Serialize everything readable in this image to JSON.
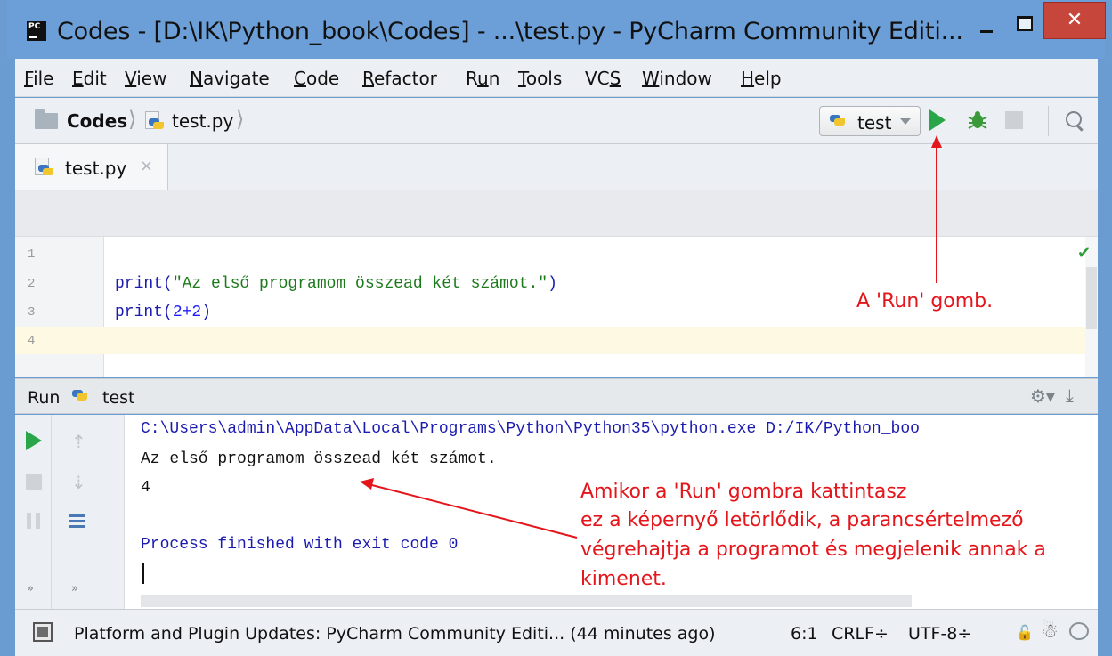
{
  "window": {
    "title": "Codes - [D:\\IK\\Python_book\\Codes] - ...\\test.py - PyCharm Community Editi...",
    "close_glyph": "✕"
  },
  "menu": [
    {
      "pre": "",
      "u": "F",
      "post": "ile"
    },
    {
      "pre": "",
      "u": "E",
      "post": "dit"
    },
    {
      "pre": "",
      "u": "V",
      "post": "iew"
    },
    {
      "pre": "",
      "u": "N",
      "post": "avigate"
    },
    {
      "pre": "",
      "u": "C",
      "post": "ode"
    },
    {
      "pre": "",
      "u": "R",
      "post": "efactor"
    },
    {
      "pre": "R",
      "u": "u",
      "post": "n"
    },
    {
      "pre": "",
      "u": "T",
      "post": "ools"
    },
    {
      "pre": "VC",
      "u": "S",
      "post": ""
    },
    {
      "pre": "",
      "u": "W",
      "post": "indow"
    },
    {
      "pre": "",
      "u": "H",
      "post": "elp"
    }
  ],
  "breadcrumb": {
    "project": "Codes",
    "file": "test.py",
    "separator": "⟩"
  },
  "run_config": {
    "selected": "test"
  },
  "tab": {
    "label": "test.py",
    "close_glyph": "×"
  },
  "editor": {
    "line_numbers": [
      "1",
      "2",
      "3",
      "4"
    ],
    "line2": {
      "func": "print(",
      "str": "\"Az első programom összead két számot.\"",
      "end": ")"
    },
    "line3": {
      "func": "print(",
      "num": "2+2",
      "end": ")"
    }
  },
  "run_panel": {
    "label": "Run",
    "tab": "test",
    "console": {
      "command": "C:\\Users\\admin\\AppData\\Local\\Programs\\Python\\Python35\\python.exe D:/IK/Python_boo",
      "output1": "Az első programom összead két számot.",
      "output2": "4",
      "exit": "Process finished with exit code 0"
    },
    "more_glyph": "»"
  },
  "statusbar": {
    "message": "Platform and Plugin Updates: PyCharm Community Editi... (44 minutes ago)",
    "position": "6:1",
    "line_sep": "CRLF÷",
    "encoding": "UTF-8÷"
  },
  "annotations": {
    "run_button": "A 'Run' gomb.",
    "console_lines": [
      "Amikor a 'Run' gombra kattintasz",
      "ez a képernyő letörlődik, a parancsértelmező",
      "végrehajtja a programot és megjelenik annak a",
      "kimenet."
    ],
    "color": "#e4161b"
  },
  "colors": {
    "titlebar": "#6c9fd7",
    "close": "#c7463b",
    "run_green": "#2aa64a",
    "code_keyword": "#1b1bb0",
    "code_string": "#1c7a1c"
  }
}
